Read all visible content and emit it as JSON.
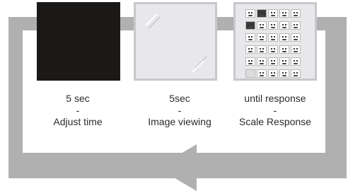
{
  "stages": [
    {
      "duration": "5 sec",
      "separator": "-",
      "name": "Adjust time"
    },
    {
      "duration": "5sec",
      "separator": "-",
      "name": "Image viewing"
    },
    {
      "duration": "until response",
      "separator": "-",
      "name": "Scale Response"
    }
  ],
  "colors": {
    "loop": "#b0b0b0",
    "blank_screen": "#1b1918",
    "panel_bg": "#e8e7ec",
    "panel_border": "#c8c8cc",
    "text": "#2b2b2b"
  },
  "icons": [
    "loop-arrow-icon",
    "glass-reflection-icon",
    "face-scale-grid-icon"
  ]
}
